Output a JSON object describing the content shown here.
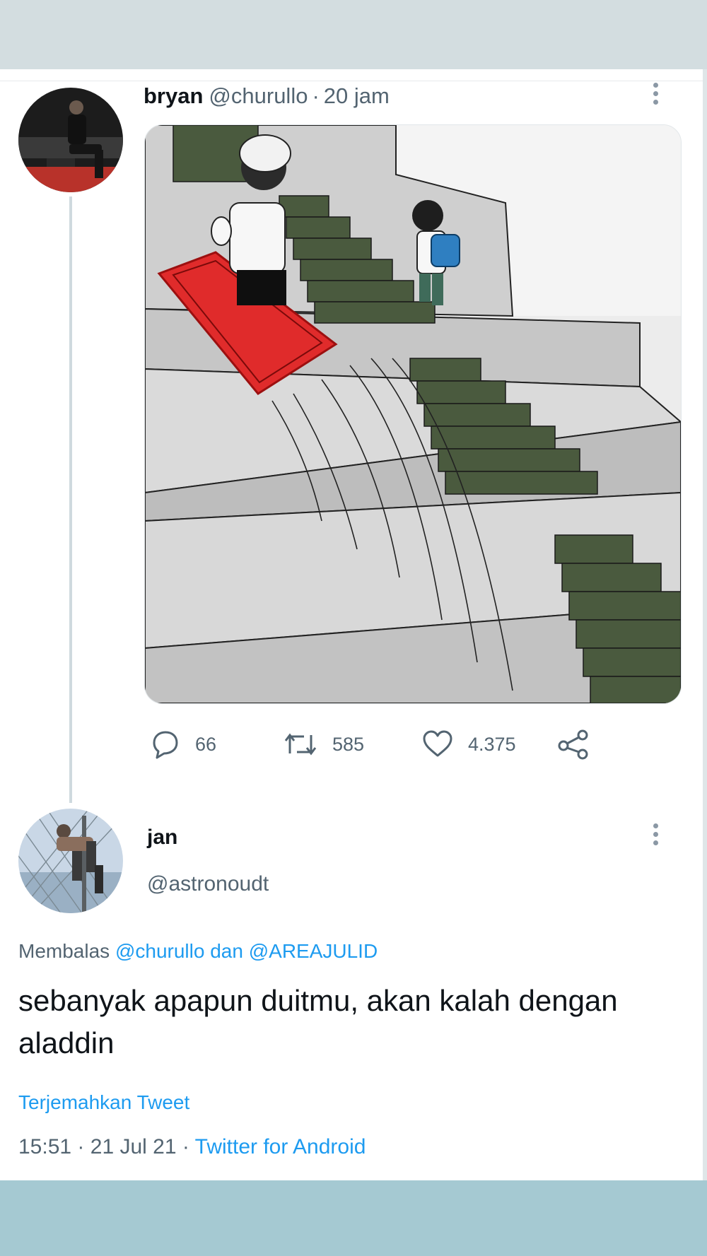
{
  "tweet": {
    "author_name": "bryan",
    "author_handle": "@churullo",
    "separator": "·",
    "time_ago": "20 jam",
    "stats": {
      "replies": "66",
      "retweets": "585",
      "likes": "4.375"
    },
    "icons": {
      "more": "more-vertical-icon",
      "reply": "reply-bubble-icon",
      "retweet": "retweet-icon",
      "like": "heart-icon",
      "share": "share-icon"
    }
  },
  "reply": {
    "author_name": "jan",
    "author_handle": "@astronoudt",
    "replying_prefix": "Membalas",
    "mention_1": "@churullo",
    "conjunction": "dan",
    "mention_2": "@AREAJULID",
    "text": "sebanyak apapun duitmu, akan kalah dengan aladdin",
    "translate": "Terjemahkan Tweet",
    "time": "15:51",
    "date": "21 Jul 21",
    "client": "Twitter for Android"
  },
  "colors": {
    "link": "#1d9bf0",
    "secondary_text": "#536471",
    "top_band": "#d3dde0",
    "bottom_band": "#a5c9d2"
  }
}
